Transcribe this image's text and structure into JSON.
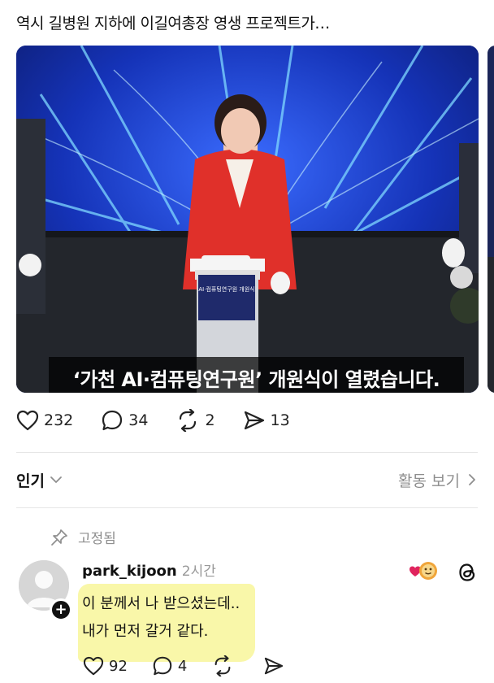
{
  "post": {
    "text": "역시 길병원 지하에 이길여총장 영생 프로젝트가…",
    "caption": "‘가천 AI·컴퓨팅연구원’ 개원식이 열렸습니다.",
    "podium_text": "AI·컴퓨팅연구원 개원식",
    "stats": {
      "likes": "232",
      "comments": "34",
      "reposts": "2",
      "shares": "13"
    }
  },
  "replies_header": {
    "sort_label": "인기",
    "activity_label": "활동 보기"
  },
  "pinned_comment": {
    "pinned_label": "고정됨",
    "username": "park_kijoon",
    "time": "2시간",
    "line1": "이 분께서 나 받으셨는데..",
    "line2": "내가 먼저 갈거 같다.",
    "likes": "92",
    "replies": "4"
  },
  "colors": {
    "highlight": "#f8f6a0",
    "jacket": "#e0302a",
    "stage_blue": "#1d3fe0"
  },
  "icons": [
    "heart-icon",
    "comment-icon",
    "repost-icon",
    "share-icon",
    "chevron-down-icon",
    "chevron-right-icon",
    "pin-icon",
    "reaction-icon",
    "threads-icon",
    "plus-icon"
  ]
}
